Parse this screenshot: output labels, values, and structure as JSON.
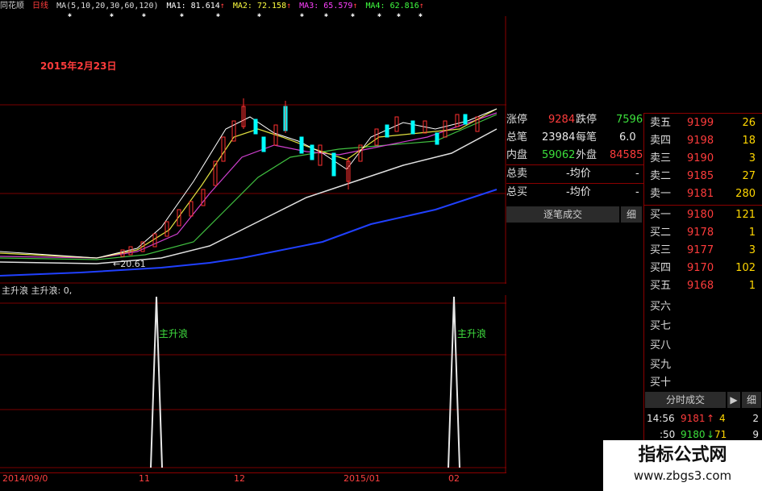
{
  "app": {
    "title": "同花顺",
    "period": "日线"
  },
  "ma_bar": {
    "params": "MA(5,10,20,30,60,120)",
    "ma1": {
      "label": "MA1:",
      "value": "81.614",
      "color": "#ffffff"
    },
    "ma2": {
      "label": "MA2:",
      "value": "72.158",
      "color": "#ffff40"
    },
    "ma3": {
      "label": "MA3:",
      "value": "65.579",
      "color": "#ff40ff"
    },
    "ma4": {
      "label": "MA4:",
      "value": "62.816",
      "color": "#40ff40"
    },
    "arrow": "↑"
  },
  "chart": {
    "date_annotation": "2015年2月23日",
    "low_label": "←20.61"
  },
  "indicator": {
    "header": "主升浪  主升浪: 0,",
    "signal_label": "主升浪"
  },
  "quote": {
    "zhangting": {
      "label": "涨停",
      "value": "9284"
    },
    "dieting": {
      "label": "跌停",
      "value": "7596"
    },
    "zongbi": {
      "label": "总笔",
      "value": "23984"
    },
    "meibi": {
      "label": "每笔",
      "value": "6.0"
    },
    "neipan": {
      "label": "内盘",
      "value": "59062"
    },
    "waipan": {
      "label": "外盘",
      "value": "84585"
    },
    "zongmai": {
      "label": "总卖",
      "value": "-均价",
      "tail": "-"
    },
    "zongmai2": {
      "label": "总买",
      "value": "-均价",
      "tail": "-"
    },
    "zhubi_button": "逐笔成交",
    "xi": "细"
  },
  "orderbook": {
    "asks": [
      {
        "label": "卖五",
        "price": "9199",
        "vol": "26"
      },
      {
        "label": "卖四",
        "price": "9198",
        "vol": "18"
      },
      {
        "label": "卖三",
        "price": "9190",
        "vol": "3"
      },
      {
        "label": "卖二",
        "price": "9185",
        "vol": "27"
      },
      {
        "label": "卖一",
        "price": "9181",
        "vol": "280"
      }
    ],
    "bids": [
      {
        "label": "买一",
        "price": "9180",
        "vol": "121"
      },
      {
        "label": "买二",
        "price": "9178",
        "vol": "1"
      },
      {
        "label": "买三",
        "price": "9177",
        "vol": "3"
      },
      {
        "label": "买四",
        "price": "9170",
        "vol": "102"
      },
      {
        "label": "买五",
        "price": "9168",
        "vol": "1"
      },
      {
        "label": "买六",
        "price": "",
        "vol": ""
      },
      {
        "label": "买七",
        "price": "",
        "vol": ""
      },
      {
        "label": "买八",
        "price": "",
        "vol": ""
      },
      {
        "label": "买九",
        "price": "",
        "vol": ""
      },
      {
        "label": "买十",
        "price": "",
        "vol": ""
      }
    ],
    "fenshi_button": "分时成交",
    "play_icon": "▶",
    "xi": "细"
  },
  "ticks": [
    {
      "time": "14:56",
      "price": "9181",
      "arrow": "↑",
      "vol": "4",
      "num": "2"
    },
    {
      "time": ":50",
      "price": "9180",
      "arrow": "↓",
      "vol": "71",
      "num": "9"
    }
  ],
  "xaxis": [
    "2014/09/0",
    "11",
    "12",
    "2015/01",
    "02"
  ],
  "watermark": {
    "title": "指标公式网",
    "url": "www.zbgs3.com"
  }
}
